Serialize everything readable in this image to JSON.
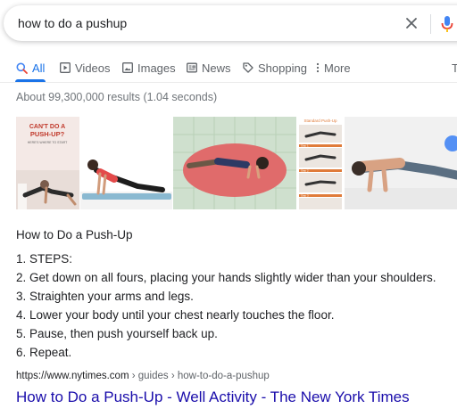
{
  "search": {
    "query": "how to do a pushup"
  },
  "tabs": [
    {
      "label": "All",
      "icon": "search-icon",
      "active": true
    },
    {
      "label": "Videos",
      "icon": "video-icon",
      "active": false
    },
    {
      "label": "Images",
      "icon": "image-icon",
      "active": false
    },
    {
      "label": "News",
      "icon": "news-icon",
      "active": false
    },
    {
      "label": "Shopping",
      "icon": "tag-icon",
      "active": false
    },
    {
      "label": "More",
      "icon": "more-vertical-icon",
      "active": false
    }
  ],
  "stats": "About 99,300,000 results (1.04 seconds)",
  "images": {
    "thumb1": {
      "line1": "CAN'T DO A",
      "line2": "PUSH-UP?",
      "line3": "HERE'S WHERE TO START"
    },
    "thumb4": {
      "title": "Standard Push-Up",
      "steps": [
        "Step 1",
        "Step 2",
        "Step 3"
      ]
    }
  },
  "answer": {
    "title": "How to Do a Push-Up",
    "steps": [
      "1. STEPS:",
      "2. Get down on all fours, placing your hands slightly wider than your shoulders.",
      "3. Straighten your arms and legs.",
      "4. Lower your body until your chest nearly touches the floor.",
      "5. Pause, then push yourself back up.",
      "6. Repeat."
    ]
  },
  "result": {
    "domain": "https://www.nytimes.com",
    "path": " › guides › how-to-do-a-pushup",
    "title": "How to Do a Push-Up - Well Activity - The New York Times"
  },
  "colors": {
    "link": "#1a0dab",
    "accent": "#1a73e8",
    "muted": "#70757a"
  }
}
